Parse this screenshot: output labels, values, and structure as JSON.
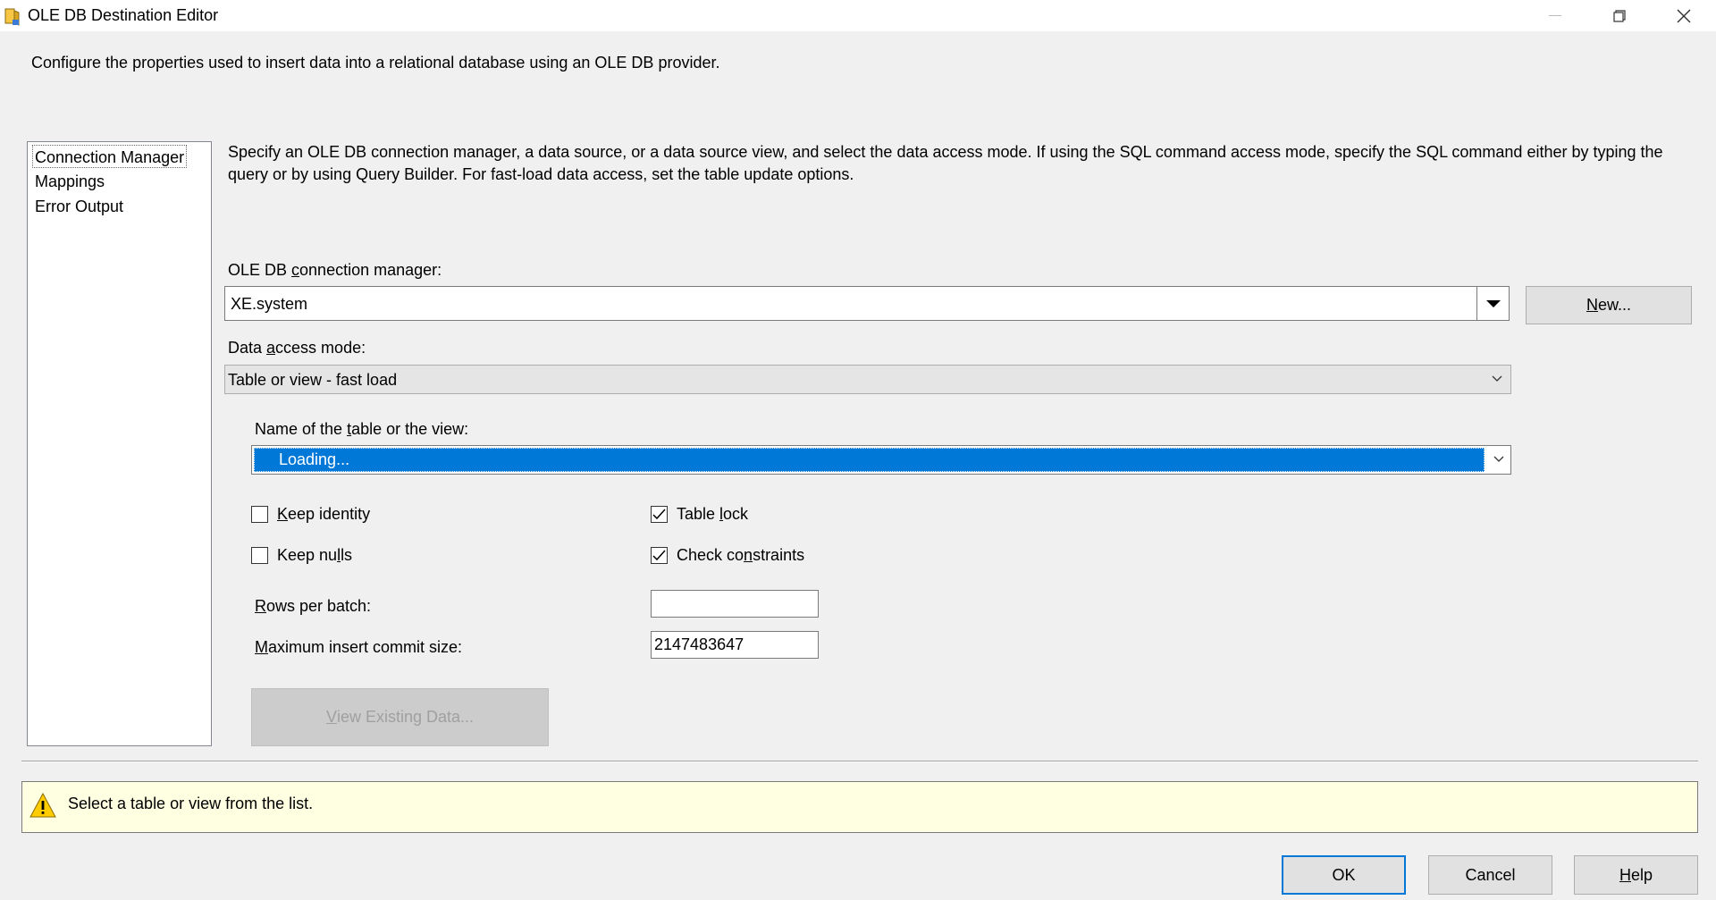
{
  "window": {
    "title": "OLE DB Destination Editor",
    "header_description": "Configure the properties used to insert data into a relational database using an OLE DB provider."
  },
  "nav": {
    "items": [
      "Connection Manager",
      "Mappings",
      "Error Output"
    ],
    "selected": "Connection Manager"
  },
  "main": {
    "description": "Specify an OLE DB connection manager, a data source, or a data source view, and select the data access mode. If using the SQL command access mode, specify the SQL command either by typing the query or by using Query Builder. For fast-load data access, set the table update options.",
    "connection_manager": {
      "label_pre": "OLE DB ",
      "label_u": "c",
      "label_post": "onnection manager:",
      "value": "XE.system",
      "new_button_u": "N",
      "new_button_rest": "ew..."
    },
    "data_access_mode": {
      "label_pre": "Data ",
      "label_u": "a",
      "label_post": "ccess mode:",
      "value": "Table or view - fast load"
    },
    "table_name": {
      "label_pre": "Name of the ",
      "label_u": "t",
      "label_post": "able or the view:",
      "value": "Loading..."
    },
    "options": {
      "keep_identity": {
        "u": "K",
        "rest": "eep identity",
        "checked": false
      },
      "keep_nulls": {
        "pre": "Keep nu",
        "u": "l",
        "rest": "ls",
        "checked": false
      },
      "table_lock": {
        "pre": "Table ",
        "u": "l",
        "rest": "ock",
        "checked": true
      },
      "check_constraints": {
        "pre": "Check co",
        "u": "n",
        "rest": "straints",
        "checked": true
      }
    },
    "rows_per_batch": {
      "u": "R",
      "rest": "ows per batch:",
      "value": ""
    },
    "max_insert_commit": {
      "u": "M",
      "rest": "aximum insert commit size:",
      "value": "2147483647"
    },
    "view_existing_button": {
      "u": "V",
      "rest": "iew Existing Data..."
    }
  },
  "message": {
    "text": "Select a table or view from the list.",
    "icon": "warning-icon"
  },
  "footer": {
    "ok": "OK",
    "cancel": "Cancel",
    "help_u": "H",
    "help_rest": "elp"
  },
  "colors": {
    "selection": "#0078d7",
    "message_bg": "#ffffe1",
    "window_bg": "#f0f0f0"
  }
}
